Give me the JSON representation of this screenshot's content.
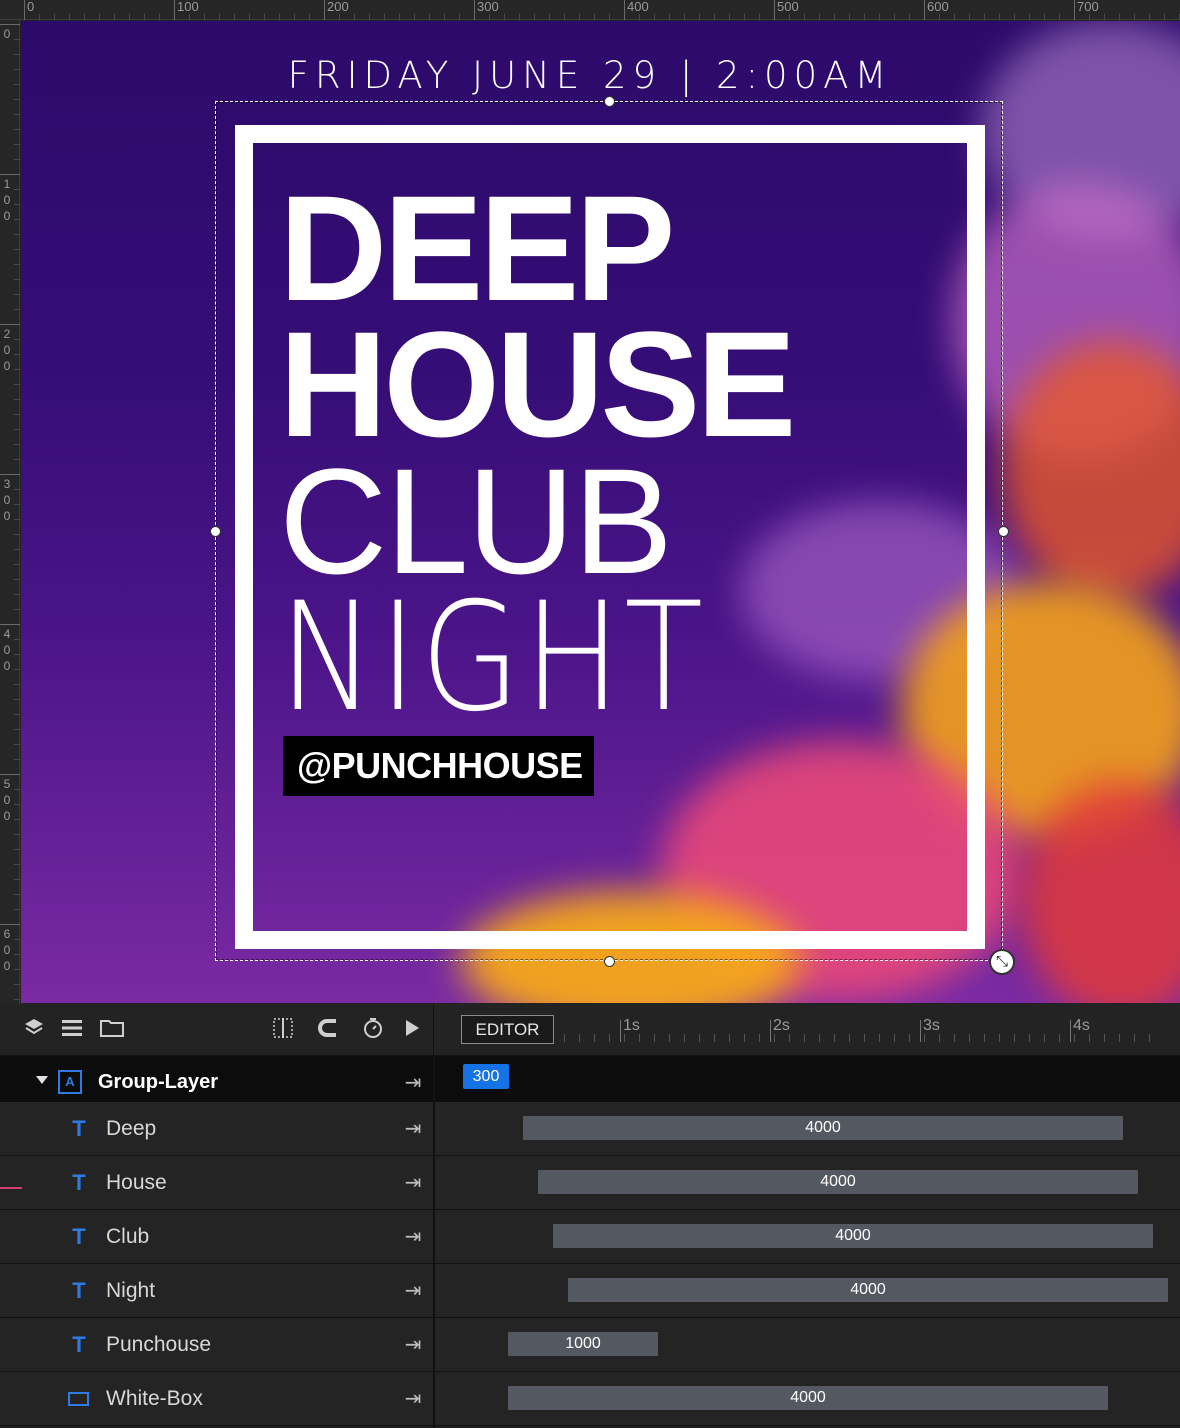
{
  "rulers": {
    "top_labels": [
      "0",
      "100",
      "200",
      "300",
      "400",
      "500",
      "600",
      "700"
    ],
    "left_labels": [
      "0",
      "100",
      "200",
      "300",
      "400",
      "500",
      "600"
    ]
  },
  "poster": {
    "date_line": "FRIDAY JUNE 29 | 2:00AM",
    "line1": "DEEP",
    "line2": "HOUSE",
    "line3": "CLUB",
    "line4": "NIGHT",
    "handle": "@PUNCHHOUSE"
  },
  "toolbar": {
    "editor_label": "EDITOR",
    "time_labels": [
      "1s",
      "2s",
      "3s",
      "4s"
    ]
  },
  "layers": {
    "group": {
      "name": "Group-Layer",
      "badge": "300"
    },
    "items": [
      {
        "name": "Deep",
        "type": "text",
        "duration": "4000"
      },
      {
        "name": "House",
        "type": "text",
        "duration": "4000"
      },
      {
        "name": "Club",
        "type": "text",
        "duration": "4000"
      },
      {
        "name": "Night",
        "type": "text",
        "duration": "4000"
      },
      {
        "name": "Punchouse",
        "type": "text",
        "duration": "1000"
      },
      {
        "name": "White-Box",
        "type": "shape",
        "duration": "4000"
      }
    ]
  },
  "colors": {
    "accent": "#1673e6",
    "layer_icon": "#2f7be5",
    "poster_purple": "#350d76"
  },
  "icons": {
    "type_icon": "T",
    "end_icon": "⇥"
  }
}
